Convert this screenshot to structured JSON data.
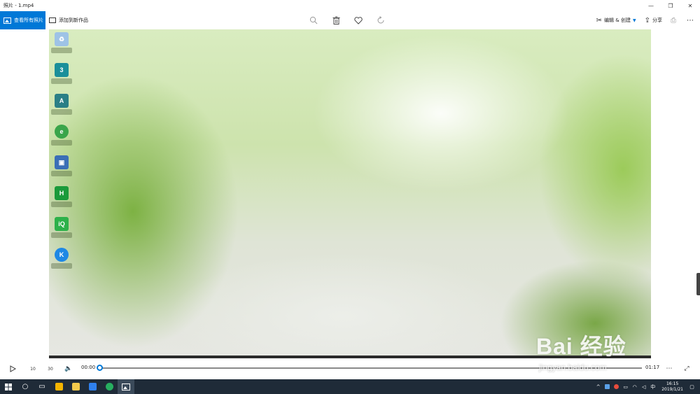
{
  "window": {
    "title": "照片 - 1.mp4",
    "minimize_glyph": "—",
    "restore_glyph": "❐",
    "close_glyph": "✕"
  },
  "toolbar": {
    "view_all_label": "查看所有照片",
    "add_to_creation_label": "添加到新作品",
    "center_icons": [
      "zoom-icon",
      "delete-icon",
      "heart-icon",
      "rotate-icon"
    ],
    "edit_create_label": "编辑 & 创建",
    "share_label": "分享",
    "accent": "#0078d7"
  },
  "player": {
    "current_time": "00:00",
    "total_time": "01:17",
    "skip_back_label": "10",
    "skip_forward_label": "30",
    "progress": 0.0
  },
  "watermark": {
    "brand": "Bai 经验",
    "url": "jingyan.baidu.com"
  },
  "taskbar": {
    "time": "16:15",
    "date": "2019/1/21",
    "ime": "中",
    "bg": "#1f2b38"
  }
}
